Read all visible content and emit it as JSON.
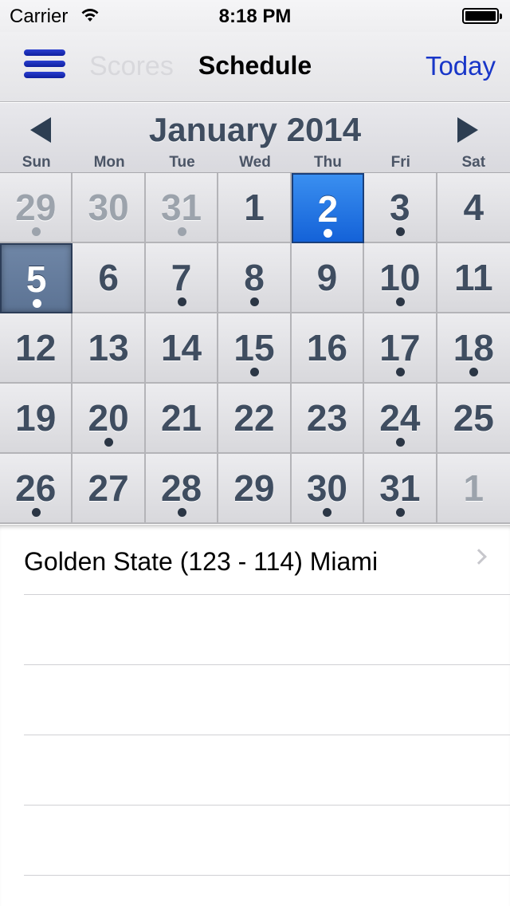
{
  "status_bar": {
    "carrier": "Carrier",
    "time": "8:18 PM"
  },
  "nav": {
    "back_title": "Scores",
    "title": "Schedule",
    "today_label": "Today"
  },
  "calendar": {
    "month_label": "January 2014",
    "weekdays": [
      "Sun",
      "Mon",
      "Tue",
      "Wed",
      "Thu",
      "Fri",
      "Sat"
    ],
    "days": [
      {
        "n": "29",
        "other": true,
        "dot": true
      },
      {
        "n": "30",
        "other": true,
        "dot": false
      },
      {
        "n": "31",
        "other": true,
        "dot": true
      },
      {
        "n": "1",
        "dot": false
      },
      {
        "n": "2",
        "dot": true,
        "state": "today"
      },
      {
        "n": "3",
        "dot": true
      },
      {
        "n": "4",
        "dot": false
      },
      {
        "n": "5",
        "dot": true,
        "state": "selected"
      },
      {
        "n": "6",
        "dot": false
      },
      {
        "n": "7",
        "dot": true
      },
      {
        "n": "8",
        "dot": true
      },
      {
        "n": "9",
        "dot": false
      },
      {
        "n": "10",
        "dot": true
      },
      {
        "n": "11",
        "dot": false
      },
      {
        "n": "12",
        "dot": false
      },
      {
        "n": "13",
        "dot": false
      },
      {
        "n": "14",
        "dot": false
      },
      {
        "n": "15",
        "dot": true
      },
      {
        "n": "16",
        "dot": false
      },
      {
        "n": "17",
        "dot": true
      },
      {
        "n": "18",
        "dot": true
      },
      {
        "n": "19",
        "dot": false
      },
      {
        "n": "20",
        "dot": true
      },
      {
        "n": "21",
        "dot": false
      },
      {
        "n": "22",
        "dot": false
      },
      {
        "n": "23",
        "dot": false
      },
      {
        "n": "24",
        "dot": true
      },
      {
        "n": "25",
        "dot": false
      },
      {
        "n": "26",
        "dot": true
      },
      {
        "n": "27",
        "dot": false
      },
      {
        "n": "28",
        "dot": true
      },
      {
        "n": "29",
        "dot": false
      },
      {
        "n": "30",
        "dot": true
      },
      {
        "n": "31",
        "dot": true
      },
      {
        "n": "1",
        "other": true,
        "dot": false
      }
    ]
  },
  "games": [
    {
      "label": "Golden State (123 - 114) Miami"
    }
  ],
  "colors": {
    "accent": "#1836c8",
    "today": "#1f74e6",
    "selected": "#5f7696",
    "day_text": "#3f4d60"
  }
}
